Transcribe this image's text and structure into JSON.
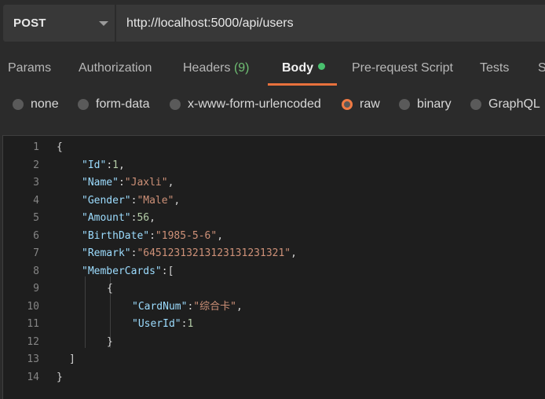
{
  "request": {
    "method": "POST",
    "url": "http://localhost:5000/api/users"
  },
  "tabs": {
    "params": "Params",
    "authorization": "Authorization",
    "headers": "Headers",
    "headers_count": "(9)",
    "body": "Body",
    "prerequest": "Pre-request Script",
    "tests": "Tests",
    "settings_partial": "S"
  },
  "body_types": {
    "none": "none",
    "form_data": "form-data",
    "urlencoded": "x-www-form-urlencoded",
    "raw": "raw",
    "binary": "binary",
    "graphql": "GraphQL",
    "selected": "raw"
  },
  "editor": {
    "line_numbers": [
      "1",
      "2",
      "3",
      "4",
      "5",
      "6",
      "7",
      "8",
      "9",
      "10",
      "11",
      "12",
      "13",
      "14"
    ],
    "lines": [
      [
        {
          "c": "p",
          "t": "{"
        }
      ],
      [
        {
          "c": "k",
          "t": "\"Id\""
        },
        {
          "c": "p",
          "t": ":"
        },
        {
          "c": "n",
          "t": "1"
        },
        {
          "c": "p",
          "t": ","
        }
      ],
      [
        {
          "c": "k",
          "t": "\"Name\""
        },
        {
          "c": "p",
          "t": ":"
        },
        {
          "c": "s",
          "t": "\"Jaxli\""
        },
        {
          "c": "p",
          "t": ","
        }
      ],
      [
        {
          "c": "k",
          "t": "\"Gender\""
        },
        {
          "c": "p",
          "t": ":"
        },
        {
          "c": "s",
          "t": "\"Male\""
        },
        {
          "c": "p",
          "t": ","
        }
      ],
      [
        {
          "c": "k",
          "t": "\"Amount\""
        },
        {
          "c": "p",
          "t": ":"
        },
        {
          "c": "n",
          "t": "56"
        },
        {
          "c": "p",
          "t": ","
        }
      ],
      [
        {
          "c": "k",
          "t": "\"BirthDate\""
        },
        {
          "c": "p",
          "t": ":"
        },
        {
          "c": "s",
          "t": "\"1985-5-6\""
        },
        {
          "c": "p",
          "t": ","
        }
      ],
      [
        {
          "c": "k",
          "t": "\"Remark\""
        },
        {
          "c": "p",
          "t": ":"
        },
        {
          "c": "s",
          "t": "\"6451231321312313123132​1\""
        },
        {
          "c": "p",
          "t": ","
        }
      ],
      [
        {
          "c": "k",
          "t": "\"MemberCards\""
        },
        {
          "c": "p",
          "t": ":["
        }
      ],
      [
        {
          "c": "p",
          "t": "{"
        }
      ],
      [
        {
          "c": "k",
          "t": "\"CardNum\""
        },
        {
          "c": "p",
          "t": ":"
        },
        {
          "c": "s",
          "t": "\"综合卡\""
        },
        {
          "c": "p",
          "t": ","
        }
      ],
      [
        {
          "c": "k",
          "t": "\"UserId\""
        },
        {
          "c": "p",
          "t": ":"
        },
        {
          "c": "n",
          "t": "1"
        }
      ],
      [
        {
          "c": "p",
          "t": "}"
        }
      ],
      [
        {
          "c": "p",
          "t": "]"
        }
      ],
      [
        {
          "c": "p",
          "t": "}"
        }
      ]
    ]
  },
  "colors": {
    "accent": "#e8713d",
    "active_dot": "#49c16e"
  }
}
